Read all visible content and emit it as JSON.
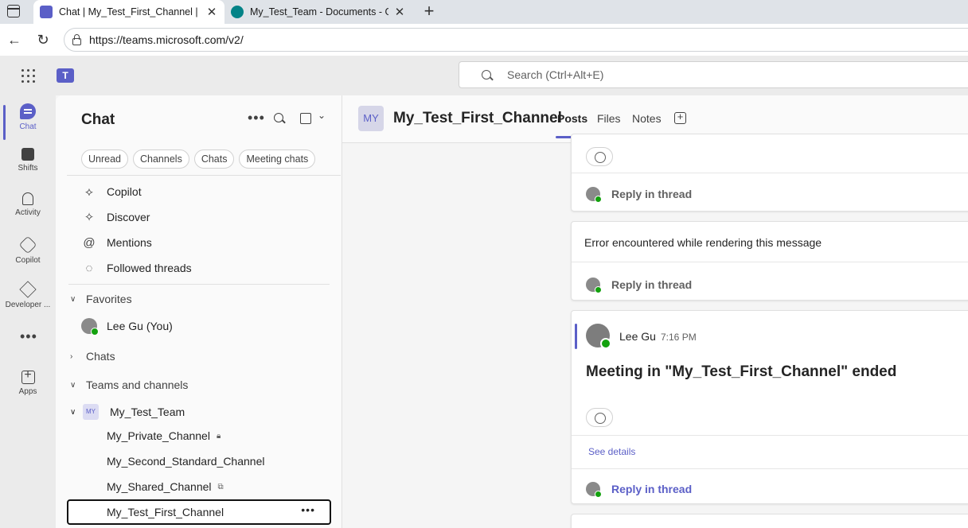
{
  "browser": {
    "tabs": [
      {
        "title": "Chat | My_Test_First_Channel | Mic",
        "close": "✕"
      },
      {
        "title": "My_Test_Team - Documents - Gen",
        "close": "✕"
      }
    ],
    "new_tab": "+",
    "url": "https://teams.microsoft.com/v2/"
  },
  "app": {
    "logo_letter": "T",
    "search_placeholder": "Search (Ctrl+Alt+E)"
  },
  "rail": [
    {
      "label": "Chat",
      "icon": "chat-icon"
    },
    {
      "label": "Shifts",
      "icon": "shifts-icon"
    },
    {
      "label": "Activity",
      "icon": "bell-icon"
    },
    {
      "label": "Copilot",
      "icon": "copilot-icon"
    },
    {
      "label": "Developer ...",
      "icon": "developer-icon"
    },
    {
      "label": "",
      "icon": "more-icon"
    },
    {
      "label": "Apps",
      "icon": "apps-icon"
    }
  ],
  "panel": {
    "title": "Chat",
    "filters": [
      "Unread",
      "Channels",
      "Chats",
      "Meeting chats"
    ],
    "quick_links": [
      "Copilot",
      "Discover",
      "Mentions",
      "Followed threads"
    ],
    "favorites_header": "Favorites",
    "favorite_contact": "Lee Gu (You)",
    "chats_header": "Chats",
    "teams_header": "Teams and channels",
    "team": {
      "badge": "MY",
      "name": "My_Test_Team"
    },
    "channels": [
      "My_Private_Channel",
      "My_Second_Standard_Channel",
      "My_Shared_Channel",
      "My_Test_First_Channel"
    ]
  },
  "main": {
    "channel_badge": "MY",
    "channel_title": "My_Test_First_Channel",
    "tabs": [
      "Posts",
      "Files",
      "Notes"
    ],
    "reply_label": "Reply in thread",
    "error_message": "Error encountered while rendering this message",
    "post": {
      "author": "Lee Gu",
      "time": "7:16 PM",
      "text": "Meeting in \"My_Test_First_Channel\" ended",
      "details_link": "See details"
    }
  },
  "colors": {
    "accent": "#5b5fc7",
    "presence_available": "#13a10e"
  }
}
